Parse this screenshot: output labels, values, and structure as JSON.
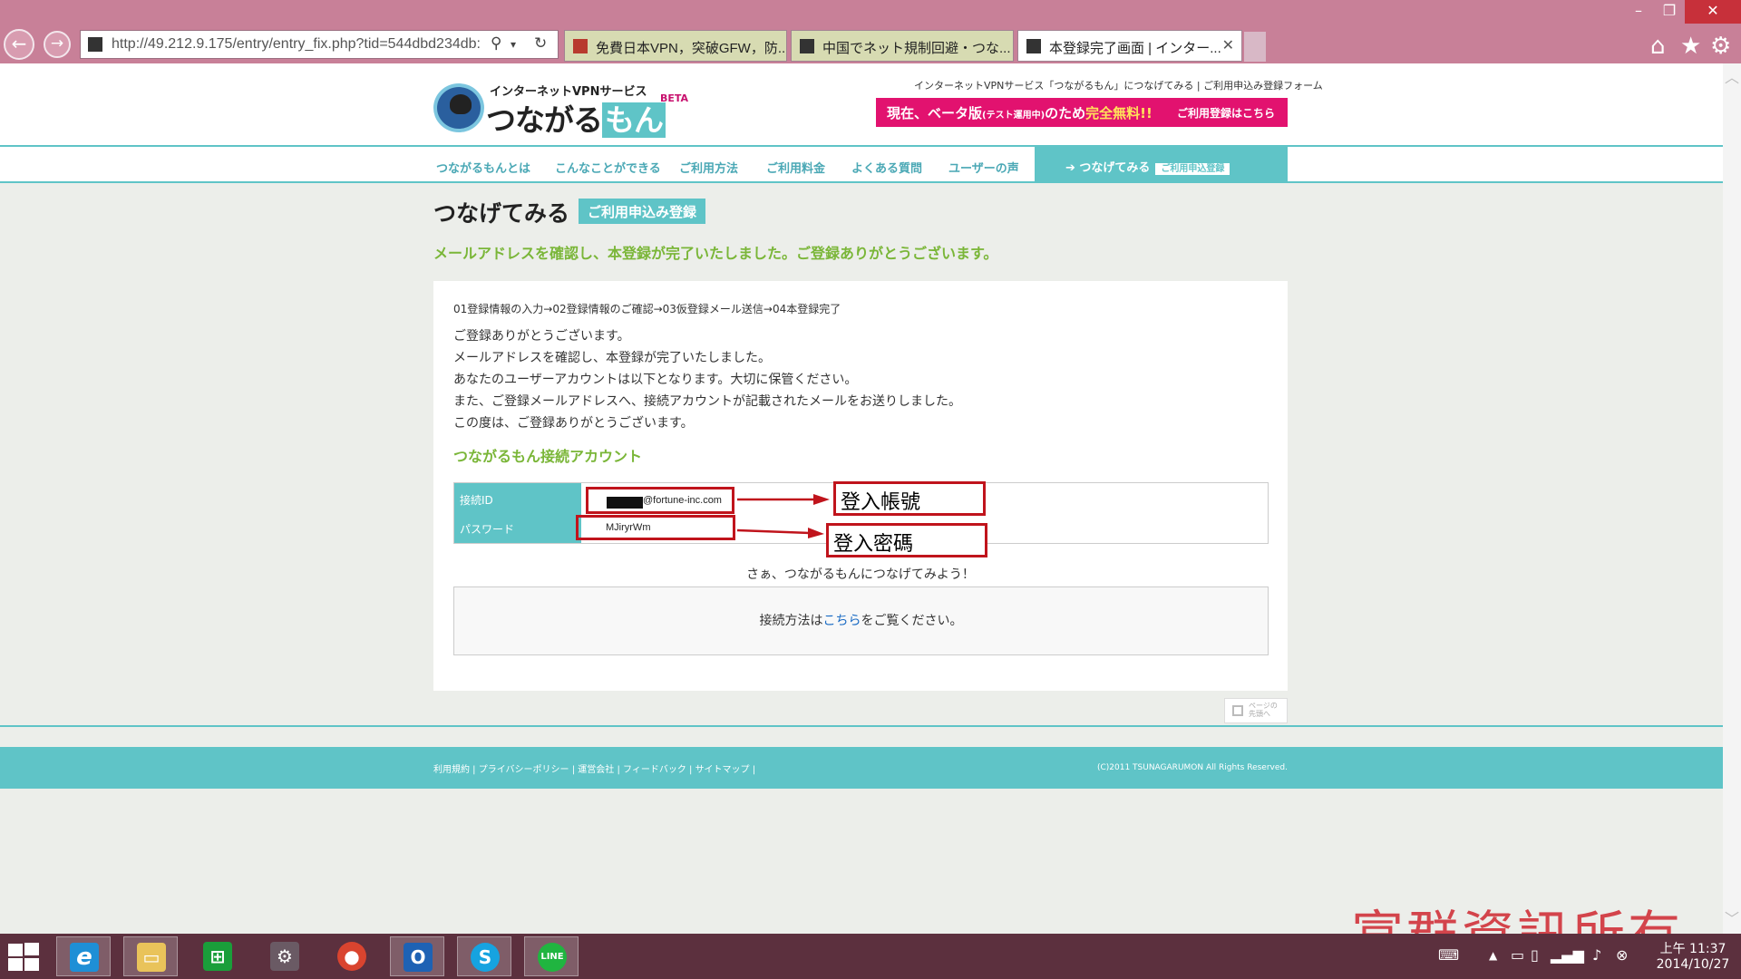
{
  "browser": {
    "url": "http://49.212.9.175/entry/entry_fix.php?tid=544dbd234db:",
    "tabs": [
      {
        "title": "免費日本VPN，突破GFW，防...",
        "fav_color": "#b83a2e"
      },
      {
        "title": "中国でネット規制回避・つな...",
        "fav_color": "#333333"
      },
      {
        "title": "本登録完了画面 | インター...",
        "fav_color": "#333333"
      }
    ],
    "icons": {
      "back": "back-arrow-icon",
      "forward": "forward-arrow-icon",
      "search": "search-icon",
      "refresh": "refresh-icon",
      "home": "home-icon",
      "favorites": "star-icon",
      "settings": "gear-icon"
    }
  },
  "site": {
    "logo_top": "インターネットVPNサービス",
    "logo_main_a": "つながる",
    "logo_main_b": "もん",
    "logo_beta": "BETA",
    "tagline": "インターネットVPNサービス「つながるもん」につなげてみる | ご利用申込み登録フォーム",
    "banner": {
      "a": "現在、ベータ版",
      "b": "(テスト運用中)",
      "c": "のため",
      "d": "完全無料!!",
      "link": "ご利用登録はこちら"
    },
    "nav": [
      "つながるもんとは",
      "こんなことができる",
      "ご利用方法",
      "ご利用料金",
      "よくある質問",
      "ユーザーの声"
    ],
    "nav_connect": "つなげてみる",
    "nav_connect_pill": "ご利用申込登録",
    "accent": "#5fc4c7",
    "green": "#7ab638",
    "pink": "#e2126f"
  },
  "page": {
    "title": "つなげてみる",
    "badge": "ご利用申込み登録",
    "lead": "メールアドレスを確認し、本登録が完了いたしました。ご登録ありがとうございます。",
    "steps": "01登録情報の入力→02登録情報のご確認→03仮登録メール送信→04本登録完了",
    "messages": [
      "ご登録ありがとうございます。",
      "メールアドレスを確認し、本登録が完了いたしました。",
      "あなたのユーザーアカウントは以下となります。大切に保管ください。",
      "また、ご登録メールアドレスへ、接続アカウントが記載されたメールをお送りしました。",
      "この度は、ご登録ありがとうございます。"
    ],
    "account_heading": "つながるもん接続アカウント",
    "id_label": "接続ID",
    "id_value": "@fortune-inc.com",
    "pw_label": "パスワード",
    "pw_value": "MJiryrWm",
    "callout_id": "登入帳號",
    "callout_pw": "登入密碼",
    "cta": "さぁ、つながるもんにつなげてみよう！",
    "howto_pre": "接続方法は",
    "howto_link": "こちら",
    "howto_post": "をご覧ください。",
    "pagetop_a": "ページの",
    "pagetop_b": "先頭へ"
  },
  "footer": {
    "links": [
      "利用規約",
      "プライバシーポリシー",
      "運営会社",
      "フィードバック",
      "サイトマップ"
    ],
    "copyright": "(C)2011 TSUNAGARUMON All Rights Reserved."
  },
  "watermark": "富群資訊所有",
  "taskbar": {
    "apps": [
      {
        "name": "internet-explorer-icon",
        "glyph": "e",
        "color": "#1e8fd6",
        "active": true
      },
      {
        "name": "file-explorer-icon",
        "glyph": "▭",
        "color": "#e9c35a",
        "active": true
      },
      {
        "name": "store-icon",
        "glyph": "⊞",
        "color": "#1a9e3a",
        "active": false
      },
      {
        "name": "device-icon",
        "glyph": "⚙",
        "color": "#6a5a64",
        "active": false
      },
      {
        "name": "chrome-icon",
        "glyph": "●",
        "color": "#d9442f",
        "active": false
      },
      {
        "name": "outlook-icon",
        "glyph": "O",
        "color": "#1e62b4",
        "active": true
      },
      {
        "name": "skype-icon",
        "glyph": "S",
        "color": "#16a3e0",
        "active": true
      },
      {
        "name": "line-icon",
        "glyph": "LINE",
        "color": "#20b540",
        "active": true
      }
    ],
    "time": "上午 11:37",
    "date": "2014/10/27"
  }
}
